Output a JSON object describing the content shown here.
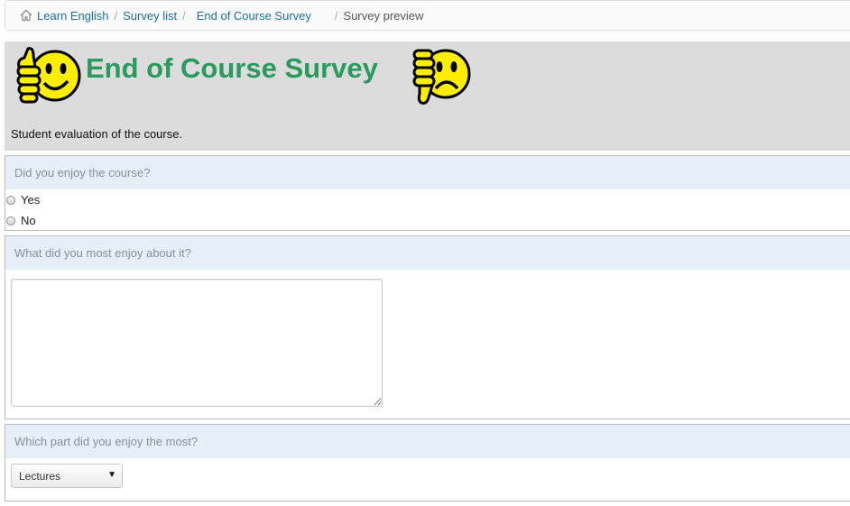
{
  "breadcrumb": {
    "items": [
      "Learn English",
      "Survey list",
      "End of Course Survey"
    ],
    "current": "Survey preview",
    "separator": "/"
  },
  "survey": {
    "title": "End of Course Survey",
    "description": "Student evaluation of the course.",
    "title_color": "#2a9a5f"
  },
  "questions": [
    {
      "text": "Did you enjoy the course?",
      "options": [
        "Yes",
        "No"
      ]
    },
    {
      "text": "What did you most enjoy about it?",
      "answer": ""
    },
    {
      "text": "Which part did you enjoy the most?",
      "selected": "Lectures"
    }
  ],
  "icons": {
    "home": "home-icon",
    "thumbs_up": "thumbs-up-smiley-icon",
    "thumbs_down": "thumbs-down-frown-icon",
    "dropdown": "chevron-down-icon"
  }
}
